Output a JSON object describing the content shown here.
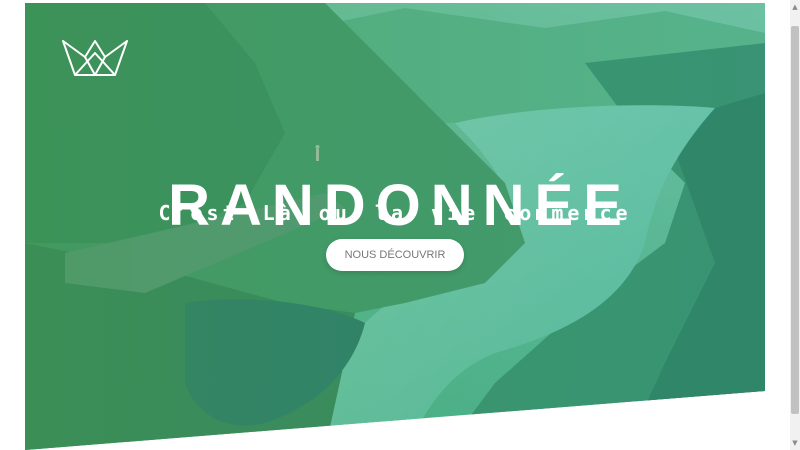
{
  "hero": {
    "title": "RANDONNÉE",
    "subtitle": "C'est Là ou la vie commence",
    "cta_label": "NOUS DÉCOUVRIR",
    "logo_icon": "crown-icon",
    "overlay_color": "#3fb37f"
  },
  "scrollbar": {
    "up_arrow": "▲",
    "down_arrow": "▼"
  }
}
